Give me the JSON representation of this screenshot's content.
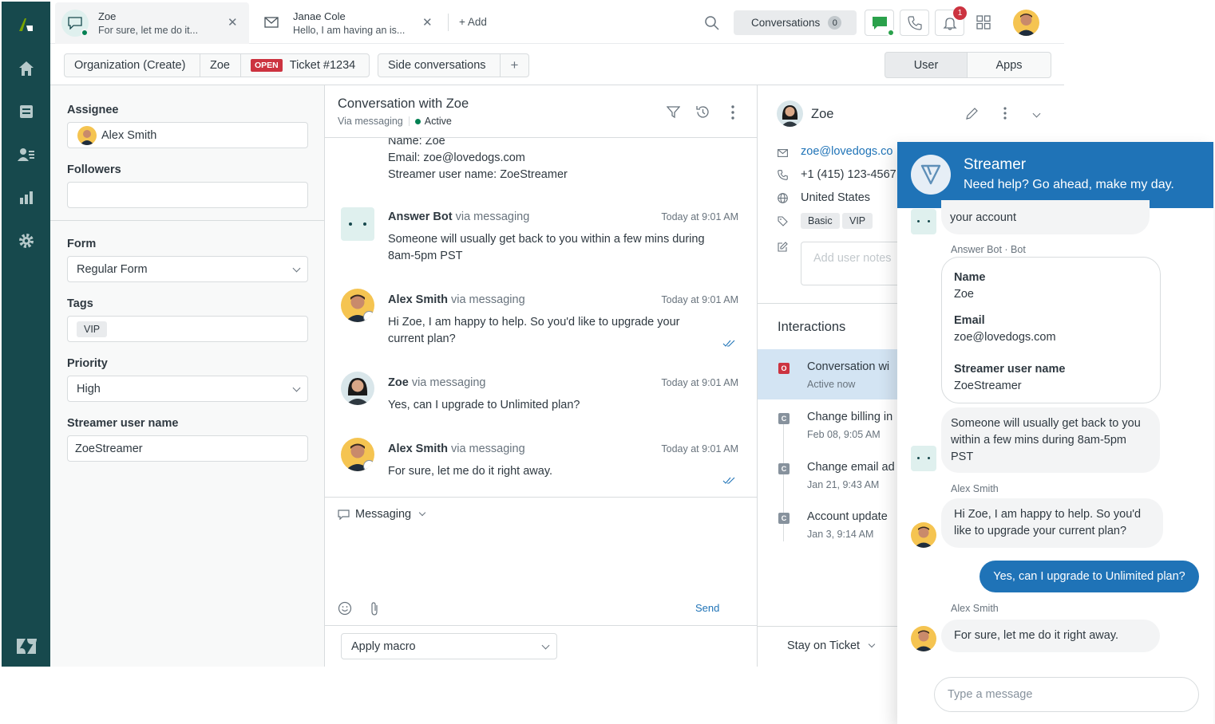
{
  "tabs": [
    {
      "name": "Zoe",
      "preview": "For sure, let me do it..."
    },
    {
      "name": "Janae Cole",
      "preview": "Hello, I am having an is..."
    }
  ],
  "add_label": "+ Add",
  "conversations": {
    "label": "Conversations",
    "count": "0"
  },
  "notification_count": "1",
  "breadcrumb": {
    "org": "Organization (Create)",
    "user": "Zoe",
    "status": "OPEN",
    "ticket": "Ticket #1234",
    "side": "Side conversations",
    "plus": "+"
  },
  "context_tabs": [
    "User",
    "Apps"
  ],
  "fields": {
    "assignee_label": "Assignee",
    "assignee_value": "Alex Smith",
    "followers_label": "Followers",
    "form_label": "Form",
    "form_value": "Regular Form",
    "tags_label": "Tags",
    "tag": "VIP",
    "priority_label": "Priority",
    "priority_value": "High",
    "streamer_label": "Streamer user name",
    "streamer_value": "ZoeStreamer"
  },
  "conversation": {
    "title": "Conversation with Zoe",
    "via": "Via messaging",
    "status": "Active",
    "intro": [
      "Name: Zoe",
      "Email: zoe@lovedogs.com",
      "Streamer user name: ZoeStreamer"
    ],
    "messages": [
      {
        "author": "Answer Bot",
        "via": "via messaging",
        "time": "Today at 9:01 AM",
        "text": "Someone will usually get back to you within a few mins during 8am-5pm PST"
      },
      {
        "author": "Alex Smith",
        "via": "via messaging",
        "time": "Today at 9:01 AM",
        "text": "Hi Zoe, I am happy to help. So you'd like to upgrade your current plan?"
      },
      {
        "author": "Zoe",
        "via": "via messaging",
        "time": "Today at 9:01 AM",
        "text": "Yes, can I upgrade to Unlimited plan?"
      },
      {
        "author": "Alex Smith",
        "via": "via messaging",
        "time": "Today at 9:01 AM",
        "text": "For sure, let me do it right away."
      }
    ],
    "channel": "Messaging",
    "send": "Send"
  },
  "footer": {
    "macro": "Apply macro",
    "stay": "Stay on Ticket"
  },
  "user": {
    "name": "Zoe",
    "email": "zoe@lovedogs.co",
    "phone": "+1 (415) 123-4567",
    "country": "United States",
    "tags": [
      "Basic",
      "VIP"
    ],
    "notes_placeholder": "Add user notes",
    "interactions_title": "Interactions",
    "interactions": [
      {
        "badge": "O",
        "title": "Conversation wi",
        "sub": "Active now"
      },
      {
        "badge": "C",
        "title": "Change billing in",
        "sub": "Feb 08, 9:05 AM"
      },
      {
        "badge": "C",
        "title": "Change email ad",
        "sub": "Jan 21, 9:43 AM"
      },
      {
        "badge": "C",
        "title": "Account update",
        "sub": "Jan 3, 9:14 AM"
      }
    ]
  },
  "widget": {
    "title": "Streamer",
    "subtitle": "Need help? Go ahead, make my day.",
    "partial": "your account",
    "bot_label": "Answer Bot · Bot",
    "card": {
      "name_label": "Name",
      "name": "Zoe",
      "email_label": "Email",
      "email": "zoe@lovedogs.com",
      "streamer_label": "Streamer user name",
      "streamer": "ZoeStreamer"
    },
    "bot_msg": "Someone will usually get back to you within a few mins during 8am-5pm PST",
    "agent_label": "Alex Smith",
    "agent_msg": "Hi Zoe, I am happy to help. So you'd like to upgrade your current plan?",
    "user_msg": "Yes, can I upgrade to Unlimited plan?",
    "agent_label2": "Alex Smith",
    "agent_msg2": "For sure, let me do it right away.",
    "input_placeholder": "Type a message"
  },
  "colors": {
    "rail": "#17494d",
    "brand_blue": "#1f73b7",
    "open_badge": "#cc3340",
    "active_green": "#038153",
    "chat_green": "#2aa14b"
  }
}
